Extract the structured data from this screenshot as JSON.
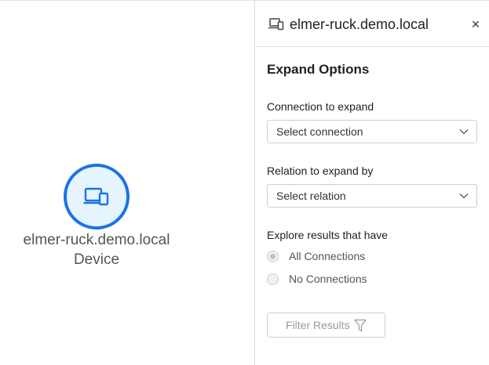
{
  "canvas": {
    "node": {
      "label": "elmer-ruck.demo.local",
      "type": "Device",
      "icon": "device-icon"
    }
  },
  "panel": {
    "title": "elmer-ruck.demo.local",
    "close_label": "×",
    "section_title": "Expand Options",
    "connection": {
      "label": "Connection to expand",
      "placeholder": "Select connection"
    },
    "relation": {
      "label": "Relation to expand by",
      "placeholder": "Select relation"
    },
    "explore": {
      "label": "Explore results that have",
      "options": [
        {
          "label": "All Connections",
          "selected": true
        },
        {
          "label": "No Connections",
          "selected": false
        }
      ]
    },
    "filter_button": {
      "label": "Filter Results",
      "icon": "funnel-icon"
    }
  },
  "colors": {
    "accent": "#1a73e8",
    "node_fill": "#e6f4fd",
    "muted_text": "#9a9a9a"
  }
}
